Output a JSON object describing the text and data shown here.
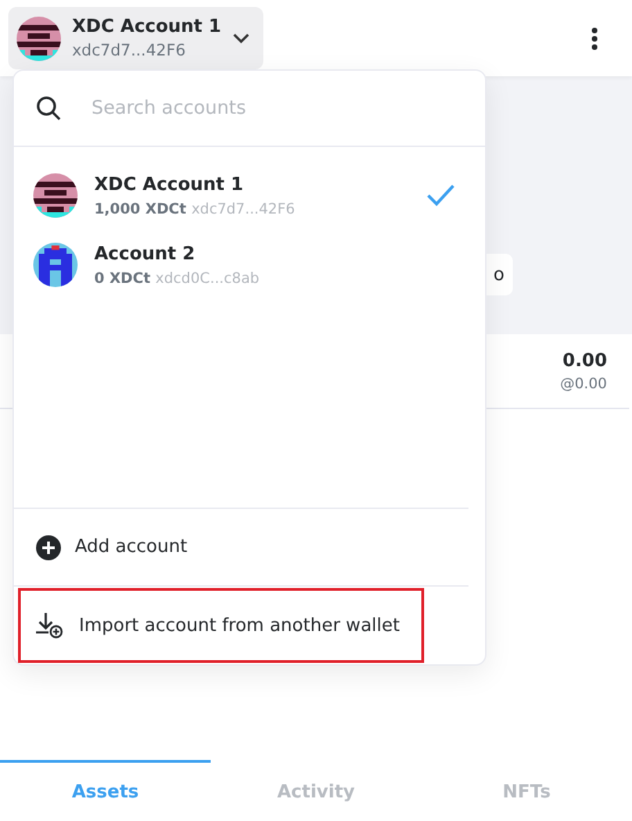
{
  "header": {
    "account_name": "XDC Account 1",
    "account_address": "xdc7d7...42F6"
  },
  "overview": {
    "button_text": "o",
    "asset": {
      "amount": "0.00",
      "fiat": "@0.00"
    }
  },
  "account_menu": {
    "search": {
      "placeholder": "Search accounts"
    },
    "accounts": [
      {
        "name": "XDC Account 1",
        "balance": "1,000 XDCt",
        "address": "xdc7d7...42F6",
        "selected": true
      },
      {
        "name": "Account 2",
        "balance": "0 XDCt",
        "address": "xdcd0C...c8ab",
        "selected": false
      }
    ],
    "actions": [
      {
        "kind": "add",
        "label": "Add account",
        "highlighted": false
      },
      {
        "kind": "import",
        "label": "Import account from another wallet",
        "highlighted": true
      }
    ]
  },
  "tabs": [
    {
      "label": "Assets",
      "selected": true
    },
    {
      "label": "Activity",
      "selected": false
    },
    {
      "label": "NFTs",
      "selected": false
    }
  ]
}
